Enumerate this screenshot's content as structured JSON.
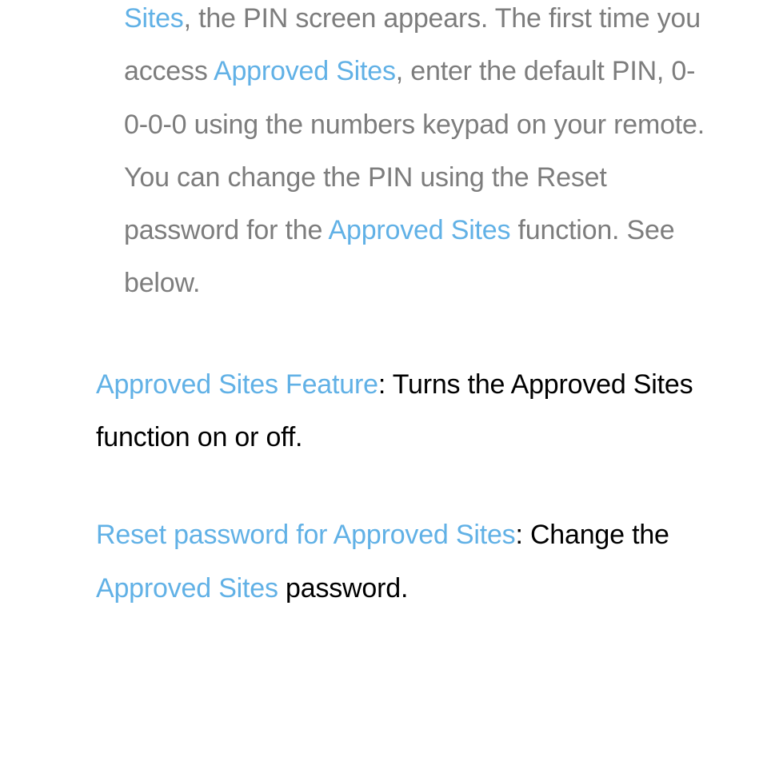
{
  "para1": {
    "link1": "Sites",
    "t1": ", the PIN screen appears. The first time you access ",
    "link2": "Approved Sites",
    "t2": ", enter the default PIN, 0-0-0-0 using the numbers keypad on your remote. You can change the PIN using the Reset password for the ",
    "link3": "Approved Sites",
    "t3": " function. See below."
  },
  "para2": {
    "link1": "Approved Sites Feature",
    "t1": ": Turns the Approved Sites function on or off."
  },
  "para3": {
    "link1": "Reset password for Approved Sites",
    "t1": ": Change the ",
    "link2": "Approved Sites",
    "t2": " password."
  }
}
